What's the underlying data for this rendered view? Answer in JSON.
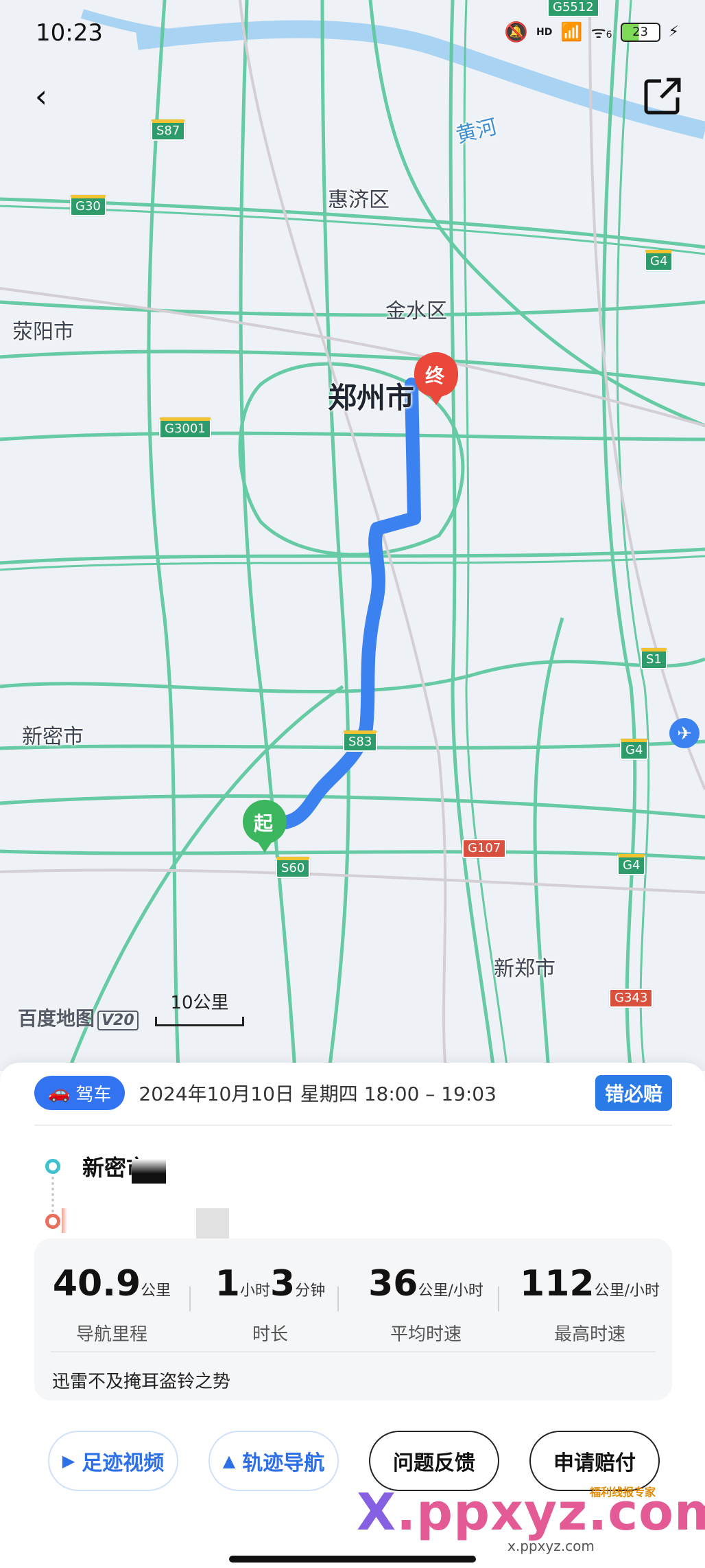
{
  "status_bar": {
    "time": "10:23",
    "hd": "HD",
    "signal_sub": "6",
    "battery": "23"
  },
  "map": {
    "places": {
      "huiji": "惠济区",
      "jinshui": "金水区",
      "zhengzhou": "郑州市",
      "xingyang": "荥阳市",
      "xinmi": "新密市",
      "xinzheng": "新郑市",
      "river": "黄河"
    },
    "roads": {
      "g5512": "G5512",
      "s87": "S87",
      "g30": "G30",
      "g4_a": "G4",
      "g3001": "G3001",
      "s1": "S1",
      "g4_b": "G4",
      "s83": "S83",
      "s60": "S60",
      "g107": "G107",
      "g4_c": "G4",
      "g343": "G343"
    },
    "markers": {
      "start": "起",
      "end": "终"
    },
    "logo": "百度地图",
    "logo_version": "V20",
    "scale": "10公里",
    "colors": {
      "route": "#3b82f0",
      "road": "#5fc8a0",
      "start": "#3bb55e",
      "end": "#e9483a"
    }
  },
  "trip": {
    "mode": "驾车",
    "datetime": "2024年10月10日 星期四 18:00 – 19:03",
    "claim": "错必赔",
    "start_name": "新密市",
    "stats": {
      "distance": {
        "value": "40.9",
        "unit": "公里",
        "label": "导航里程"
      },
      "duration": {
        "h": "1",
        "h_unit": "小时",
        "m": "3",
        "m_unit": "分钟",
        "label": "时长"
      },
      "avg_speed": {
        "value": "36",
        "unit": "公里/小时",
        "label": "平均时速"
      },
      "max_speed": {
        "value": "112",
        "unit": "公里/小时",
        "label": "最高时速"
      }
    },
    "comment": "迅雷不及掩耳盗铃之势"
  },
  "actions": {
    "video": "足迹视频",
    "track_nav": "轨迹导航",
    "feedback": "问题反馈",
    "claim": "申请赔付"
  },
  "watermark": {
    "x": "X",
    "main": ".ppxyz.com",
    "small": "x.ppxyz.com",
    "tag": "福利线报专家"
  }
}
